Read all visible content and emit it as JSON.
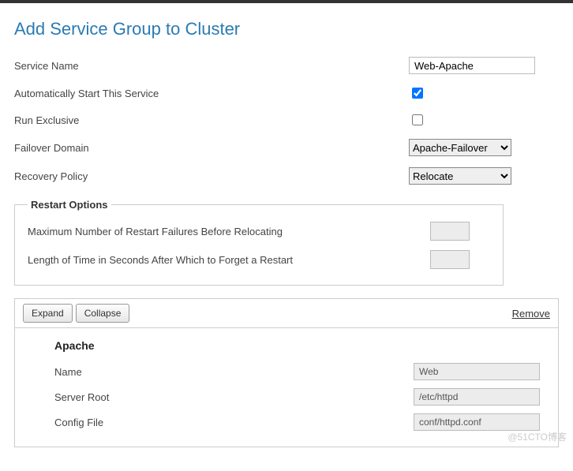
{
  "page": {
    "title": "Add Service Group to Cluster"
  },
  "form": {
    "service_name_label": "Service Name",
    "service_name_value": "Web-Apache",
    "auto_start_label": "Automatically Start This Service",
    "auto_start_checked": true,
    "run_exclusive_label": "Run Exclusive",
    "run_exclusive_checked": false,
    "failover_domain_label": "Failover Domain",
    "failover_domain_value": "Apache-Failover",
    "recovery_policy_label": "Recovery Policy",
    "recovery_policy_value": "Relocate"
  },
  "restart": {
    "legend": "Restart Options",
    "max_failures_label": "Maximum Number of Restart Failures Before Relocating",
    "max_failures_value": "",
    "forget_time_label": "Length of Time in Seconds After Which to Forget a Restart",
    "forget_time_value": ""
  },
  "resource_bar": {
    "expand": "Expand",
    "collapse": "Collapse",
    "remove": "Remove"
  },
  "resource": {
    "title": "Apache",
    "name_label": "Name",
    "name_value": "Web",
    "server_root_label": "Server Root",
    "server_root_value": "/etc/httpd",
    "config_file_label": "Config File",
    "config_file_value": "conf/httpd.conf"
  },
  "watermark": "@51CTO博客"
}
